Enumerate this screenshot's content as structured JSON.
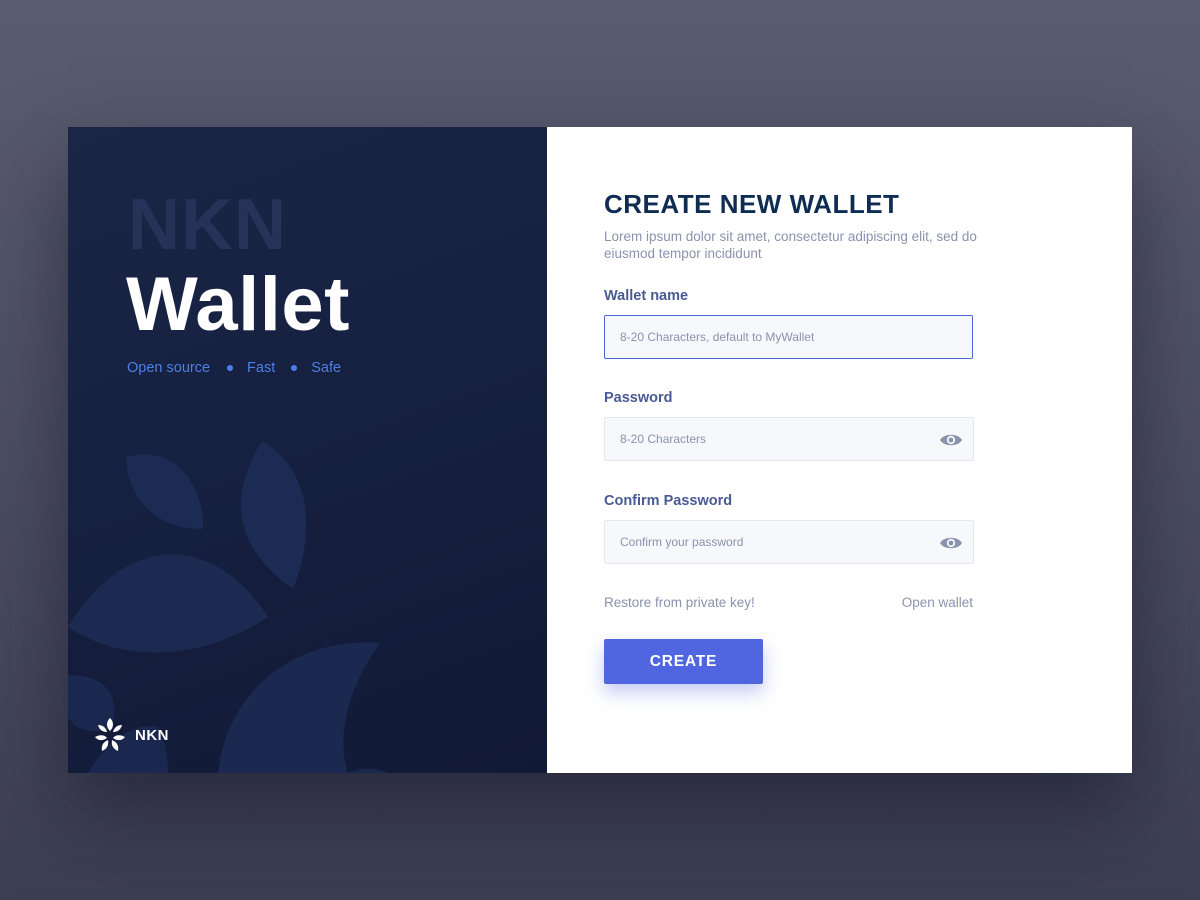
{
  "brand": {
    "sub": "NKN",
    "title": "Wallet",
    "tags": [
      "Open source",
      "Fast",
      "Safe"
    ],
    "logo_text": "NKN",
    "logo_icon": "nkn-leaf-logo-icon"
  },
  "form": {
    "title": "CREATE NEW WALLET",
    "description": "Lorem ipsum dolor sit amet, consectetur adipiscing elit, sed do eiusmod tempor incididunt",
    "wallet_name": {
      "label": "Wallet name",
      "placeholder": "8-20 Characters, default to MyWallet",
      "value": ""
    },
    "password": {
      "label": "Password",
      "placeholder": "8-20 Characters",
      "value": "",
      "icon": "eye-icon"
    },
    "confirm_password": {
      "label": "Confirm Password",
      "placeholder": "Confirm your password",
      "value": "",
      "icon": "eye-icon"
    },
    "restore_link": "Restore from private key!",
    "open_link": "Open wallet",
    "create_label": "CREATE"
  },
  "colors": {
    "left_panel": "#162040",
    "title": "#0f2d52",
    "accent": "#4f66e0",
    "tagline": "#4d7fe6",
    "label": "#4a5a94",
    "muted": "#8a93ad"
  }
}
